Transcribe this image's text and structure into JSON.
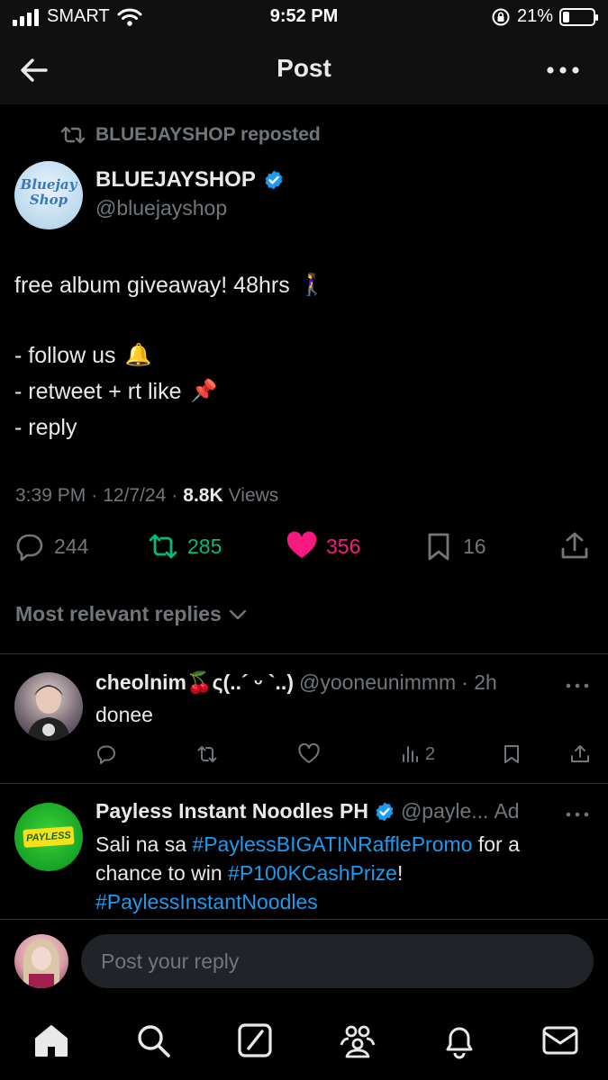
{
  "status": {
    "carrier": "SMART",
    "time": "9:52 PM",
    "battery_text": "21%",
    "battery_level": 0.21
  },
  "nav": {
    "title": "Post",
    "back_icon": "arrow-left-icon",
    "more_icon": "more-horizontal-icon"
  },
  "post": {
    "repost_by": "BLUEJAYSHOP reposted",
    "author_name": "BLUEJAYSHOP",
    "author_handle": "@bluejayshop",
    "avatar_text_1": "Bluejay",
    "avatar_text_2": "Shop",
    "lines": [
      {
        "text": "free album giveaway! 48hrs",
        "emoji": "🚶‍♀️"
      },
      {
        "text": "- follow us",
        "emoji": "🔔"
      },
      {
        "text": "- retweet + rt like",
        "emoji": "📌"
      },
      {
        "text": "- reply",
        "emoji": ""
      }
    ],
    "time": "3:39 PM",
    "date": "12/7/24",
    "views_count": "8.8K",
    "views_label": "Views",
    "replies": "244",
    "reposts": "285",
    "likes": "356",
    "bookmarks": "16"
  },
  "replies_filter": "Most relevant replies",
  "replies": [
    {
      "name": "cheolnim🍒ς(..´ ᵕ `..)",
      "handle": "@yooneunimmm",
      "age": "· 2h",
      "text": "donee",
      "views": "2"
    }
  ],
  "ad": {
    "name": "Payless Instant Noodles PH",
    "handle": "@payle...",
    "ad_label": "Ad",
    "logo_text": "PAYLESS",
    "text_1": "Sali na sa ",
    "tag_1": "#PaylessBIGATINRafflePromo",
    "text_2": " for a",
    "text_3": "chance to win ",
    "tag_2": "#P100KCashPrize",
    "text_4": "!",
    "tag_3": "#PaylessInstantNoodles"
  },
  "composer": {
    "placeholder": "Post your reply"
  },
  "colors": {
    "accent": "#1d9bf0",
    "repost_green": "#00ba7c",
    "like_pink": "#f91880",
    "muted": "#71767b"
  },
  "tabs": [
    "home-icon",
    "search-icon",
    "grok-icon",
    "communities-icon",
    "notifications-icon",
    "messages-icon"
  ]
}
